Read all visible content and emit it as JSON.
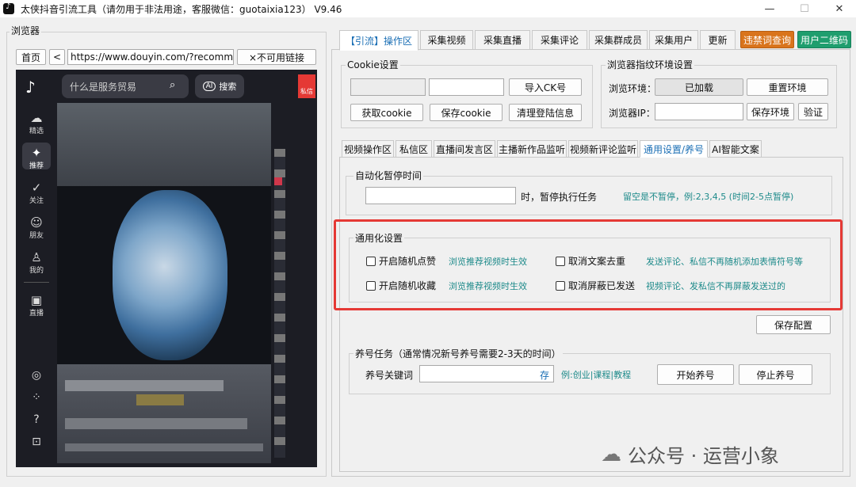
{
  "window": {
    "title": "太侠抖音引流工具（请勿用于非法用途，客服微信：guotaixia123）  V9.46",
    "min_glyph": "—",
    "max_glyph": "☐",
    "close_glyph": "✕"
  },
  "browser": {
    "group_title": "浏览器",
    "home_label": "首页",
    "back_label": "<",
    "url_value": "https://www.douyin.com/?recommend",
    "bad_link_label": "×不可用链接",
    "search_placeholder": "什么是服务贸易",
    "search_btn_label": "搜索",
    "ai_label": "AI",
    "msg_label": "私信",
    "sidebar": [
      {
        "icon": "☁",
        "label": "精选"
      },
      {
        "icon": "✦",
        "label": "推荐"
      },
      {
        "icon": "✓",
        "label": "关注"
      },
      {
        "icon": "☺",
        "label": "朋友"
      },
      {
        "icon": "♙",
        "label": "我的"
      },
      {
        "icon": "▣",
        "label": "直播"
      }
    ],
    "sidebar_bottom": [
      "◎",
      "⁘",
      "?",
      "⊡"
    ]
  },
  "top_tabs": [
    "【引流】操作区",
    "采集视频",
    "采集直播",
    "采集评论",
    "采集群成员",
    "采集用户",
    "更新"
  ],
  "accent_buttons": {
    "banned_words": "违禁词查询",
    "user_qr": "用户二维码"
  },
  "cookie": {
    "group_title": "Cookie设置",
    "import_ck": "导入CK号",
    "get_cookie": "获取cookie",
    "save_cookie": "保存cookie",
    "clear_login": "清理登陆信息"
  },
  "fingerprint": {
    "group_title": "浏览器指纹环境设置",
    "env_label": "浏览环境：",
    "env_status": "已加载",
    "reset_env": "重置环境",
    "ip_label": "浏览器IP：",
    "save_env": "保存环境",
    "verify": "验证"
  },
  "sub_tabs": [
    "视频操作区",
    "私信区",
    "直播间发言区",
    "主播新作品监听",
    "视频新评论监听",
    "通用设置/养号",
    "AI智能文案"
  ],
  "auto_pause": {
    "group_title": "自动化暂停时间",
    "suffix": "时，暂停执行任务",
    "hint": "留空是不暂停，例:2,3,4,5  (时间2-5点暂停)"
  },
  "general": {
    "group_title": "通用化设置",
    "items": [
      {
        "label": "开启随机点赞",
        "hint": "浏览推荐视频时生效"
      },
      {
        "label": "取消文案去重",
        "hint": "发送评论、私信不再随机添加表情符号等"
      },
      {
        "label": "开启随机收藏",
        "hint": "浏览推荐视频时生效"
      },
      {
        "label": "取消屏蔽已发送",
        "hint": "视频评论、发私信不再屏蔽发送过的"
      }
    ],
    "save_config": "保存配置"
  },
  "nurture": {
    "group_title": "养号任务（通常情况新号养号需要2-3天的时间）",
    "keyword_label": "养号关键词",
    "save_glyph": "存",
    "example": "例:创业|课程|教程",
    "start": "开始养号",
    "stop": "停止养号"
  },
  "watermark": "公众号 · 运营小象",
  "colors": {
    "highlight": "#e53935",
    "orange": "#d9741c",
    "green": "#1f9e6e",
    "teal": "#1d8a8a"
  }
}
